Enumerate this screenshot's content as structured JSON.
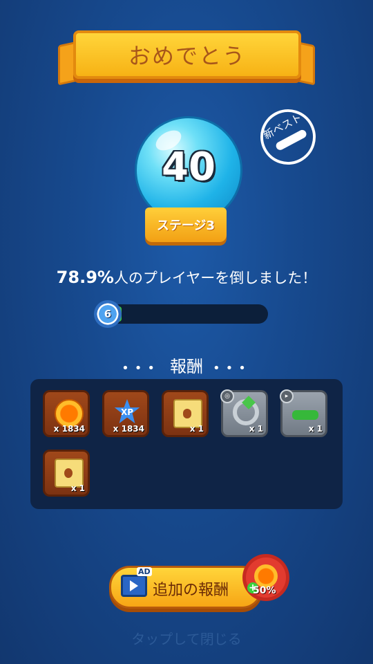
{
  "header": {
    "title": "おめでとう"
  },
  "orb": {
    "score": "40",
    "stage_label": "ステージ3"
  },
  "new_best": {
    "label": "新ベスト"
  },
  "result": {
    "percent": "78.9%",
    "text": "人のプレイヤーを倒しました！"
  },
  "xp": {
    "level": "6",
    "progress": 0.0
  },
  "rewards": {
    "title": "報酬",
    "items": [
      {
        "icon": "coin-icon",
        "qty": "x 1834"
      },
      {
        "icon": "xp-star-icon",
        "label": "XP",
        "qty": "x 1834"
      },
      {
        "icon": "scroll-icon",
        "qty": "x 1"
      },
      {
        "icon": "ring-icon",
        "qty": "x 1"
      },
      {
        "icon": "trap-icon",
        "qty": "x 1"
      },
      {
        "icon": "scroll-key-icon",
        "qty": "x 1"
      }
    ]
  },
  "ad_button": {
    "label": "追加の報酬",
    "ad_tag": "AD",
    "bonus": "50%"
  },
  "footer": {
    "close_text": "タップして閉じる"
  }
}
